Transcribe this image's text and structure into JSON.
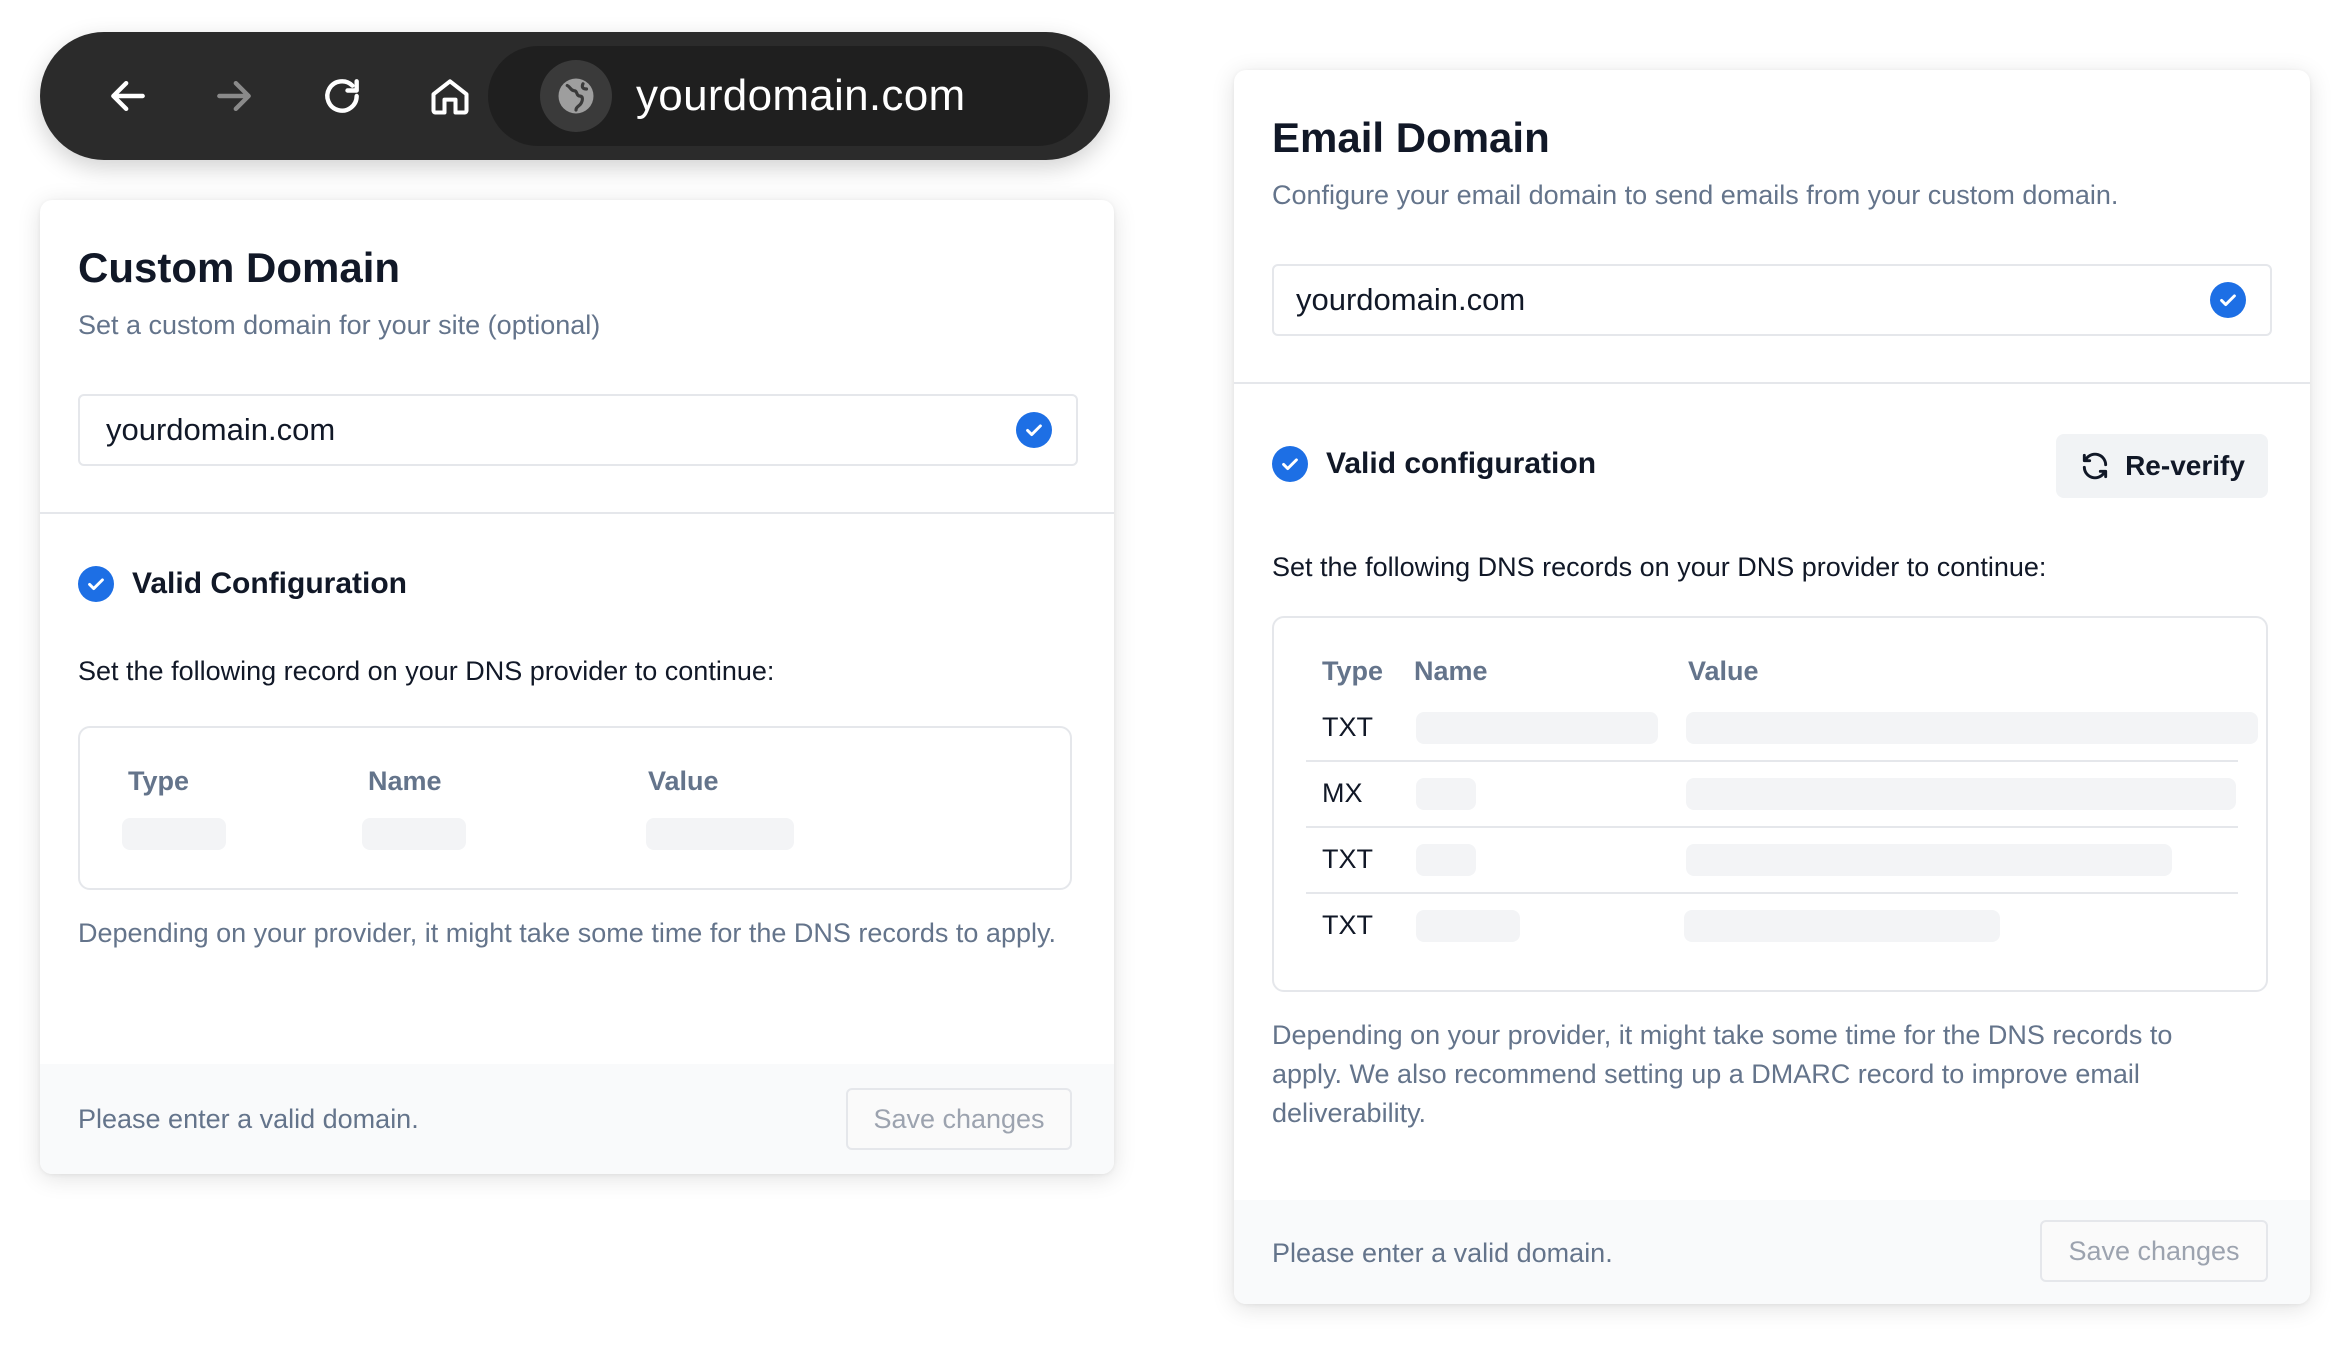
{
  "browser": {
    "url": "yourdomain.com",
    "icons": {
      "back": "arrow-left-icon",
      "forward": "arrow-right-icon",
      "reload": "reload-icon",
      "home": "home-icon",
      "site": "globe-icon"
    }
  },
  "custom_domain": {
    "title": "Custom Domain",
    "subtitle": "Set a custom domain for your site (optional)",
    "input_value": "yourdomain.com",
    "status": "Valid Configuration",
    "instruction": "Set the following record on your DNS provider to continue:",
    "columns": [
      "Type",
      "Name",
      "Value"
    ],
    "note": "Depending on your provider, it might take some time for the DNS records to apply.",
    "footer_message": "Please enter a valid domain.",
    "save_label": "Save changes"
  },
  "email_domain": {
    "title": "Email Domain",
    "subtitle": "Configure your email domain to send emails from your custom domain.",
    "input_value": "yourdomain.com",
    "status": "Valid configuration",
    "reverify_label": "Re-verify",
    "instruction": "Set the following DNS records on your DNS provider to continue:",
    "columns": [
      "Type",
      "Name",
      "Value"
    ],
    "records": [
      {
        "type": "TXT"
      },
      {
        "type": "MX"
      },
      {
        "type": "TXT"
      },
      {
        "type": "TXT"
      }
    ],
    "note": "Depending on your provider, it might take some time for the DNS records to apply. We also recommend setting up a DMARC record to improve email deliverability.",
    "footer_message": "Please enter a valid domain.",
    "save_label": "Save changes"
  },
  "colors": {
    "accent": "#1d6fe5",
    "muted_text": "#64748b",
    "border": "#e5e7eb",
    "browser_bar": "#2b2b2b"
  }
}
